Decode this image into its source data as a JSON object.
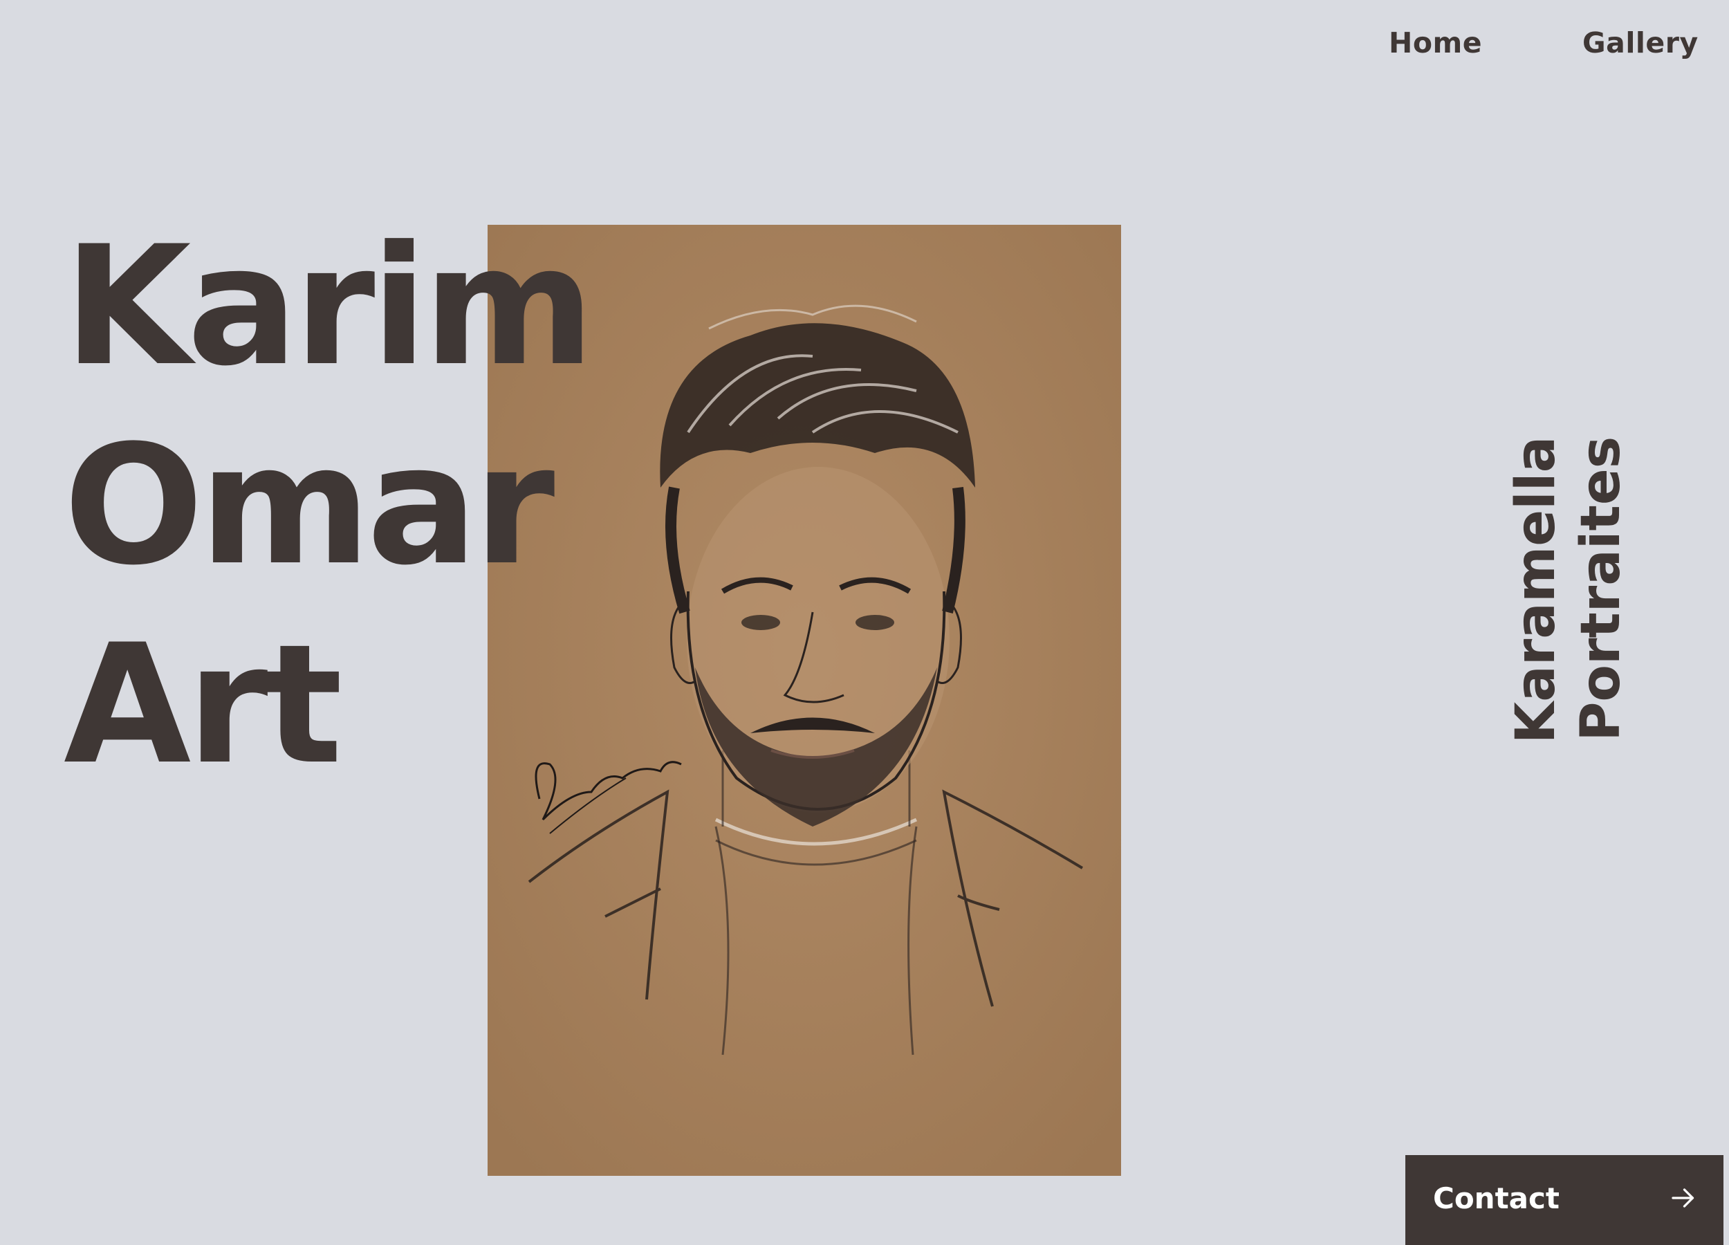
{
  "nav": {
    "home": "Home",
    "gallery": "Gallery"
  },
  "hero": {
    "title_lines": [
      "Karim",
      "Omar",
      "Art"
    ],
    "side_text": [
      "Karamella",
      "Portraites"
    ]
  },
  "contact": {
    "label": "Contact",
    "icon": "arrow-right-icon"
  },
  "portrait": {
    "alt": "Pencil sketch portrait of a bearded man on brown paper"
  },
  "colors": {
    "background": "#d9dbe1",
    "text": "#3f3735",
    "paper": "#a8835f"
  }
}
